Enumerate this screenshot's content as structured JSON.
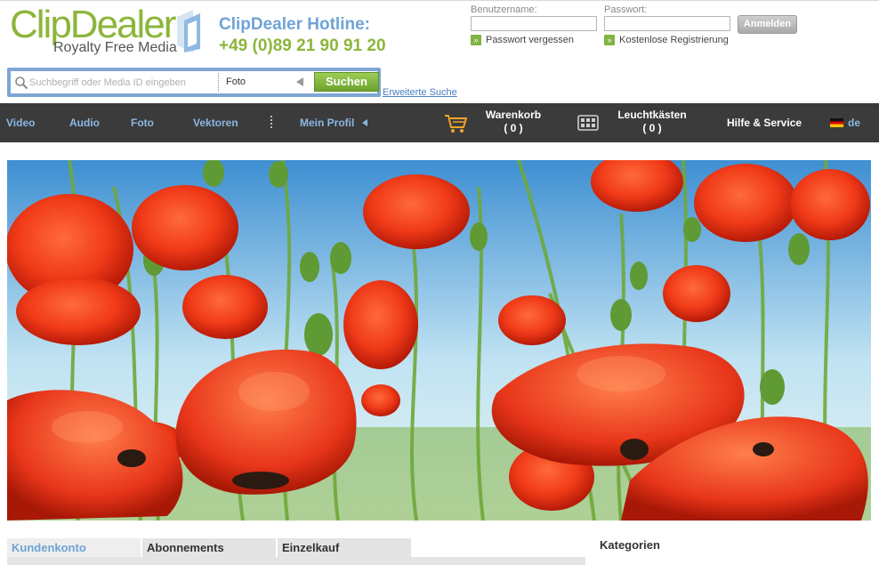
{
  "header": {
    "logo_main": "ClipDealer",
    "logo_sub": "Royalty Free Media",
    "hotline_title": "ClipDealer Hotline:",
    "hotline_number": "+49 (0)89 21 90 91 20"
  },
  "login": {
    "username_label": "Benutzername:",
    "password_label": "Passwort:",
    "login_button": "Anmelden",
    "forgot_password": "Passwort vergessen",
    "register": "Kostenlose Registrierung"
  },
  "search": {
    "placeholder": "Suchbegriff oder Media ID eingeben",
    "media_type": "Foto",
    "button": "Suchen",
    "advanced": "Erweiterte Suche"
  },
  "nav": {
    "video": "Video",
    "audio": "Audio",
    "foto": "Foto",
    "vektoren": "Vektoren",
    "mein_profil": "Mein Profil",
    "warenkorb": "Warenkorb",
    "warenkorb_count": "( 0 )",
    "leuchtkaesten": "Leuchtkästen",
    "leuchtkaesten_count": "( 0 )",
    "hilfe": "Hilfe & Service",
    "language": "de"
  },
  "tabs": {
    "kundenkonto": "Kundenkonto",
    "abonnements": "Abonnements",
    "einzelkauf": "Einzelkauf"
  },
  "sidebar": {
    "title": "Kategorien"
  },
  "colors": {
    "brand_green": "#8cb63c",
    "brand_blue": "#6fa3d6",
    "nav_bg": "#3b3b3b",
    "nav_link": "#8bb7e4"
  }
}
